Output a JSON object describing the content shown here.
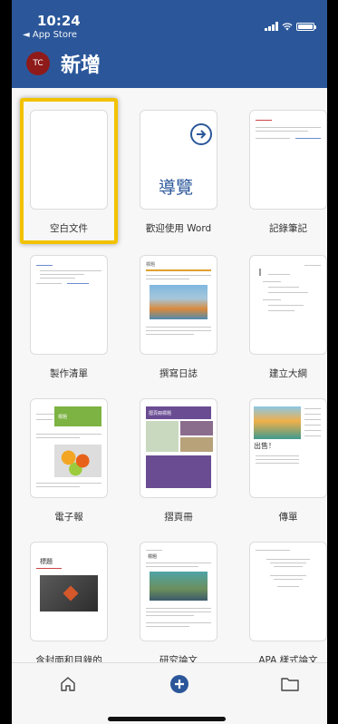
{
  "status": {
    "time": "10:24",
    "back_label": "◄ App Store"
  },
  "header": {
    "avatar_initials": "TC",
    "title": "新增"
  },
  "templates": [
    {
      "label": "空白文件",
      "selected": true
    },
    {
      "label": "歡迎使用 Word",
      "thumb_text": "導覽"
    },
    {
      "label": "記錄筆記"
    },
    {
      "label": "製作清單"
    },
    {
      "label": "撰寫日誌",
      "thumb_text": "標題"
    },
    {
      "label": "建立大綱"
    },
    {
      "label": "電子報",
      "thumb_text": "標題"
    },
    {
      "label": "摺頁冊",
      "thumb_text": "摺頁冊標題"
    },
    {
      "label": "傳單",
      "thumb_text": "出售！"
    },
    {
      "label": "含封面和目錄的",
      "thumb_text": "標題"
    },
    {
      "label": "研究論文",
      "thumb_text": "標題"
    },
    {
      "label": "APA 樣式論文"
    }
  ],
  "nav": {
    "home": "home-icon",
    "new": "plus-icon",
    "files": "folder-icon"
  },
  "colors": {
    "header": "#2b579a",
    "selection": "#f2c200",
    "avatar": "#8e1a1a"
  }
}
